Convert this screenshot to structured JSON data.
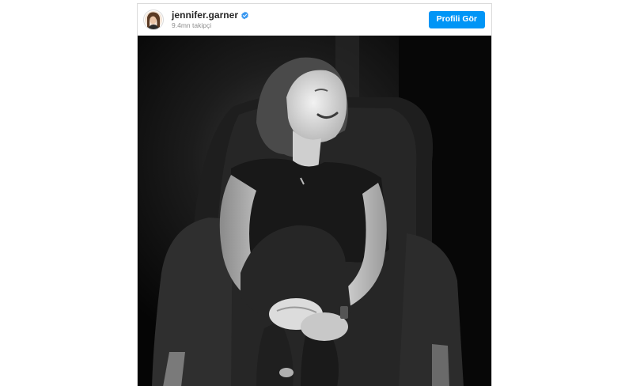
{
  "post": {
    "username": "jennifer.garner",
    "verified": true,
    "followers": "9.4mn takipçi",
    "view_profile_label": "Profili Gör"
  },
  "icons": {
    "avatar": "profile-photo-avatar",
    "verified": "verified-badge-icon"
  },
  "colors": {
    "button_blue": "#0095f6",
    "verified_blue": "#3897f0",
    "username_text": "#262626",
    "secondary_text": "#8e8e8e",
    "border": "#dbdbdb"
  }
}
